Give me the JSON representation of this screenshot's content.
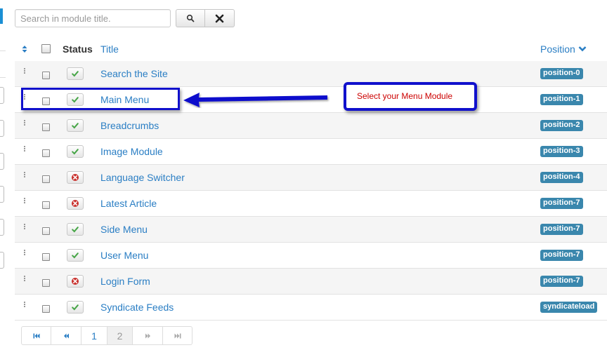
{
  "search": {
    "placeholder": "Search in module title.",
    "search_icon": "search-icon",
    "clear_icon": "close-icon"
  },
  "table": {
    "headers": {
      "order_icon": "sort-icon",
      "status": "Status",
      "title": "Title",
      "position": "Position",
      "position_icon": "chevron-down-icon"
    },
    "rows": [
      {
        "title": "Search the Site",
        "status": "published",
        "position": "position-0"
      },
      {
        "title": "Main Menu",
        "status": "published",
        "position": "position-1"
      },
      {
        "title": "Breadcrumbs",
        "status": "published",
        "position": "position-2"
      },
      {
        "title": "Image Module",
        "status": "published",
        "position": "position-3"
      },
      {
        "title": "Language Switcher",
        "status": "unpublished",
        "position": "position-4"
      },
      {
        "title": "Latest Article",
        "status": "unpublished",
        "position": "position-7"
      },
      {
        "title": "Side Menu",
        "status": "published",
        "position": "position-7"
      },
      {
        "title": "User Menu",
        "status": "published",
        "position": "position-7"
      },
      {
        "title": "Login Form",
        "status": "unpublished",
        "position": "position-7"
      },
      {
        "title": "Syndicate Feeds",
        "status": "published",
        "position": "syndicateload"
      }
    ]
  },
  "annotation": {
    "callout_text": "Select your Menu Module",
    "highlight_color": "#1010cc",
    "text_color": "#cc0000"
  },
  "pagination": {
    "first_icon": "first-page-icon",
    "prev_icon": "previous-page-icon",
    "pages": [
      "1",
      "2"
    ],
    "active_page": "2",
    "next_icon": "next-page-icon",
    "last_icon": "last-page-icon"
  },
  "colors": {
    "link": "#2a7ec4",
    "badge": "#3a87ad",
    "published": "#46a546",
    "unpublished": "#c9302c",
    "edge_accent": "#1a8fd4"
  }
}
